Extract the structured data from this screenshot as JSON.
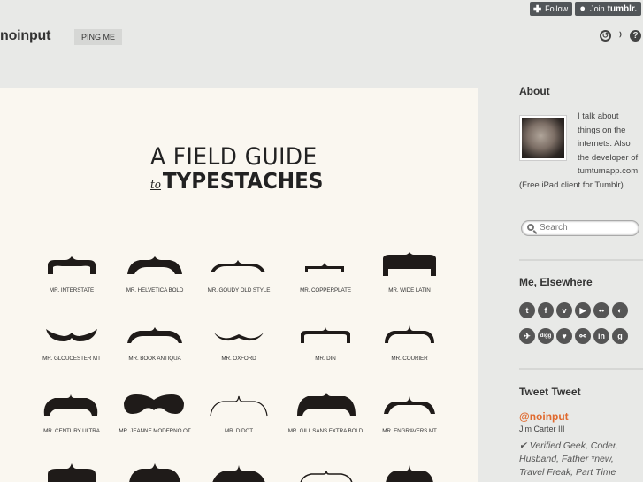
{
  "topbar": {
    "follow": "Follow",
    "join": "Join",
    "join_brand": "tumblr."
  },
  "header": {
    "title": "noinput",
    "ping": "PING ME"
  },
  "post": {
    "title_line1": "A FIELD GUIDE",
    "title_to": "to",
    "title_line2": "TYPESTACHES",
    "row1": [
      "MR. INTERSTATE",
      "MR. HELVETICA BOLD",
      "MR. GOUDY OLD STYLE",
      "MR. COPPERPLATE",
      "MR. WIDE LATIN"
    ],
    "row2": [
      "MR. GLOUCESTER MT",
      "MR. BOOK ANTIQUA",
      "MR. OXFORD",
      "MR. DIN",
      "MR. COURIER"
    ],
    "row3": [
      "MR. CENTURY ULTRA",
      "MR. JEANNE MODERNO OT",
      "MR. DIDOT",
      "MR. GILL SANS EXTRA BOLD",
      "MR. ENGRAVERS MT"
    ]
  },
  "sidebar": {
    "about_heading": "About",
    "about_text": "I talk about things on the internets. Also the developer of tumtumapp.com (Free iPad client for Tumblr).",
    "search_placeholder": "Search",
    "elsewhere_heading": "Me, Elsewhere",
    "social_icons": [
      "tumblr-icon",
      "facebook-icon",
      "vimeo-icon",
      "youtube-icon",
      "flickr-icon",
      "pinwheel-icon",
      "pin-icon",
      "digg-icon",
      "heart-icon",
      "share-icon",
      "linkedin-icon",
      "google-icon"
    ],
    "social_glyphs": [
      "t",
      "f",
      "v",
      "▶",
      "••",
      "◐",
      "✈",
      "digg",
      "♥",
      "⚯",
      "in",
      "g"
    ],
    "tweet_heading": "Tweet Tweet",
    "tweet_handle": "@noinput",
    "tweet_name": "Jim Carter III",
    "tweet_bio": "✔ Verified Geek, Coder, Husband, Father *new, Travel Freak, Part Time"
  },
  "colors": {
    "accent": "#e06a2f",
    "background": "#e8e9e7",
    "post_bg": "#faf7f0"
  }
}
